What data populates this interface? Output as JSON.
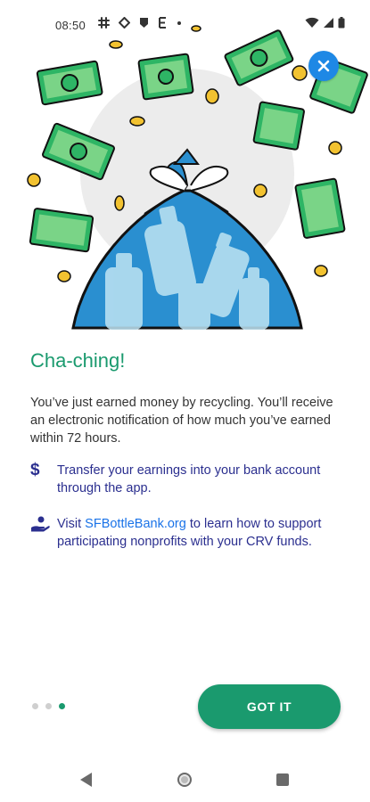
{
  "status_bar": {
    "time": "08:50",
    "left_icons": [
      "slack-icon",
      "diamond-icon",
      "shield-icon",
      "e-icon",
      "dot-icon"
    ],
    "right_icons": [
      "wifi-icon",
      "signal-icon",
      "battery-icon"
    ]
  },
  "hero": {
    "illustration": "money-bag-of-bottles",
    "close_icon": "close-icon"
  },
  "content": {
    "title": "Cha-ching!",
    "body": "You’ve just earned money by recycling. You’ll receive an electronic notification of how much you’ve earned within 72 hours.",
    "tips": [
      {
        "icon": "dollar-icon",
        "text": "Transfer your earnings into your bank account through the app."
      },
      {
        "icon": "hand-coin-icon",
        "prefix": "Visit ",
        "link": "SFBottleBank.org",
        "suffix": " to learn how to support participating nonprofits with your CRV funds."
      }
    ]
  },
  "footer": {
    "page_count": 3,
    "active_page": 3,
    "button_label": "GOT IT"
  },
  "colors": {
    "accent": "#1a9a6e",
    "tip_text": "#2b2f8f",
    "link": "#1a73e8",
    "close_button": "#1e88e5",
    "bag_blue": "#2a8fd0",
    "money_green": "#2eb565"
  }
}
